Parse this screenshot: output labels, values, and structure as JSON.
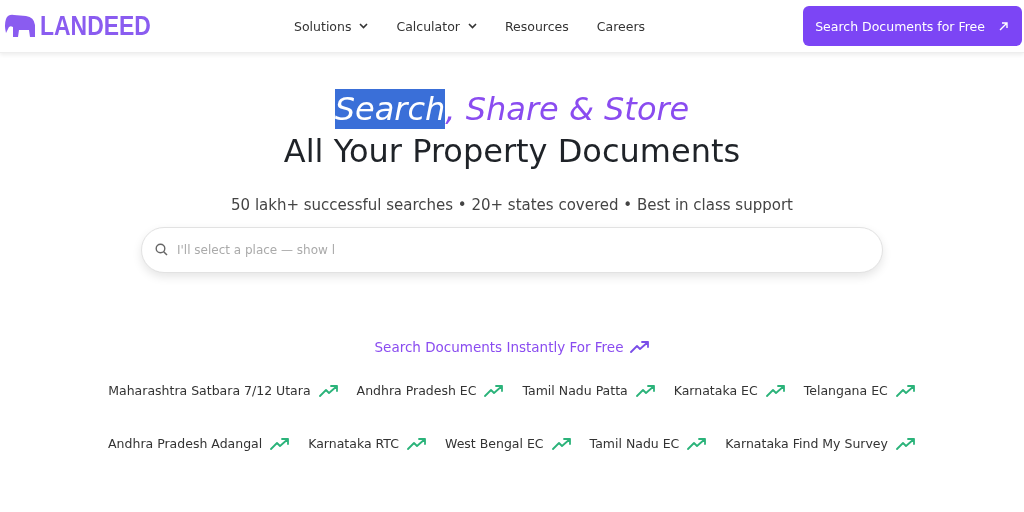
{
  "header": {
    "logo": "LANDEED",
    "nav": [
      {
        "label": "Solutions",
        "dropdown": true
      },
      {
        "label": "Calculator",
        "dropdown": true
      },
      {
        "label": "Resources",
        "dropdown": false
      },
      {
        "label": "Careers",
        "dropdown": false
      }
    ],
    "cta": "Search Documents for Free"
  },
  "hero": {
    "title_parts": [
      {
        "text": "Search",
        "highlighted": true
      },
      {
        "text": ", Share & Store",
        "highlighted": false
      }
    ],
    "title_line2": "All Your Property Documents",
    "subtitle": "50 lakh+ successful searches • 20+ states covered • Best in class support",
    "search": {
      "placeholder": "I'll select a place — show l"
    }
  },
  "quick_links": {
    "heading": "Search Documents Instantly For Free",
    "rows": [
      [
        "Maharashtra Satbara 7/12 Utara",
        "Andhra Pradesh EC",
        "Tamil Nadu Patta",
        "Karnataka EC",
        "Telangana EC"
      ],
      [
        "Andhra Pradesh Adangal",
        "Karnataka RTC",
        "West Bengal EC",
        "Tamil Nadu EC",
        "Karnataka Find My Survey"
      ]
    ]
  }
}
